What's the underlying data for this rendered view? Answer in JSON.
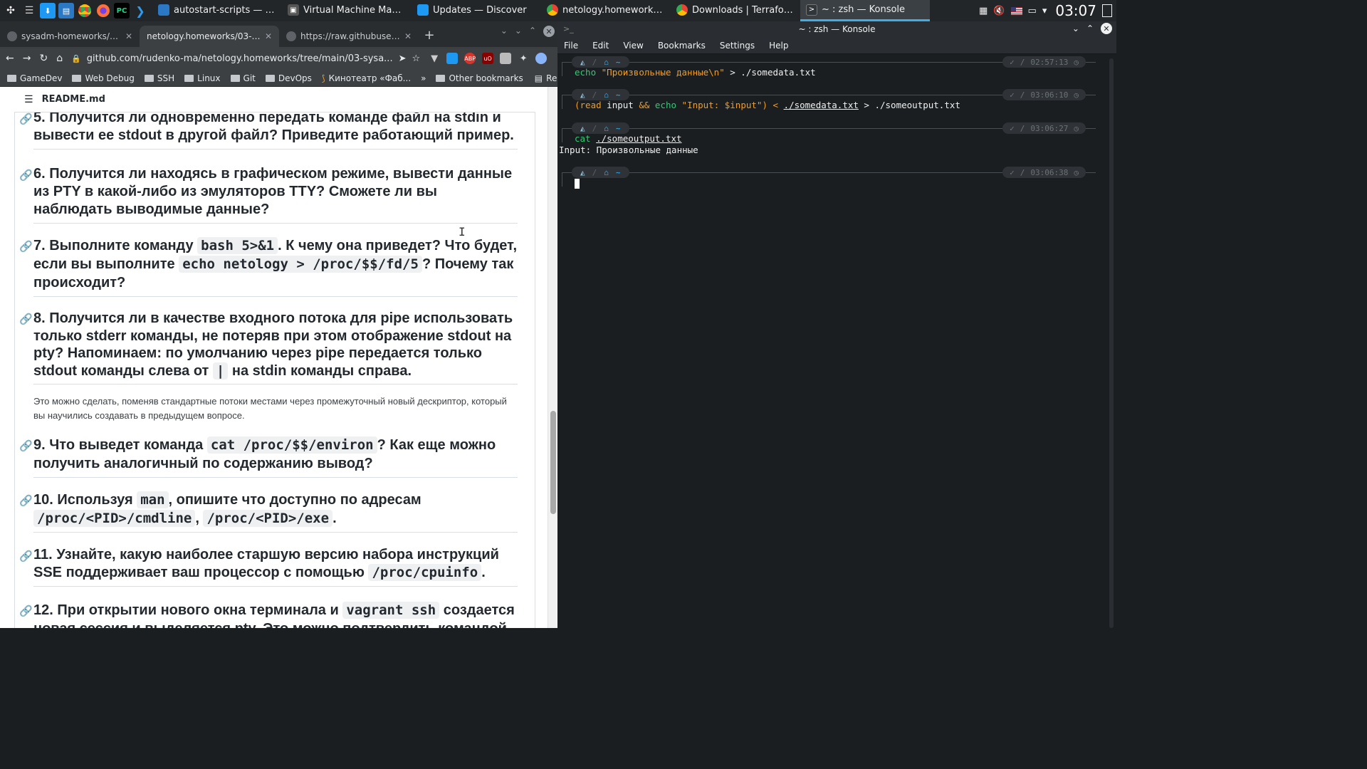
{
  "panel": {
    "tasks": [
      {
        "label": "autostart-scripts — Dolphin",
        "color": "#2b78c5"
      },
      {
        "label": "Virtual Machine Manager",
        "color": "#555"
      },
      {
        "label": "Updates — Discover",
        "color": "#1d99f3"
      },
      {
        "label": "netology.homeworks/03-sysad...",
        "color": "#e0453a"
      },
      {
        "label": "Downloads | Terraform by Has...",
        "color": "#e0453a"
      },
      {
        "label": "~ : zsh — Konsole",
        "color": "#31363b"
      }
    ],
    "clock": "03:07"
  },
  "browser": {
    "tabs": [
      {
        "label": "sysadm-homeworks/README.m"
      },
      {
        "label": "netology.homeworks/03-sysa"
      },
      {
        "label": "https://raw.githubuserconte"
      }
    ],
    "url": "github.com/rudenko-ma/netology.homeworks/tree/main/03-sysa...",
    "bookmarks": [
      "GameDev",
      "Web Debug",
      "SSH",
      "Linux",
      "Git",
      "DevOps",
      "Кинотеатр «Фаб..."
    ],
    "bookmarks_more": "»",
    "other_bookmarks": "Other bookmarks",
    "reading_list": "Reading list"
  },
  "readme": {
    "file": "README.md",
    "q5": "5. Получится ли одновременно передать команде файл на stdin и вывести ее stdout в другой файл? Приведите работающий пример.",
    "q6": "6. Получится ли находясь в графическом режиме, вывести данные из PTY в какой-либо из эмуляторов TTY? Сможете ли вы наблюдать выводимые данные?",
    "q7_a": "7. Выполните команду ",
    "q7_code1": "bash 5>&1",
    "q7_b": ". К чему она приведет? Что будет, если вы выполните ",
    "q7_code2": "echo netology > /proc/$$/fd/5",
    "q7_c": "? Почему так происходит?",
    "q8_a": "8. Получится ли в качестве входного потока для pipe использовать только stderr команды, не потеряв при этом отображение stdout на pty? Напоминаем: по умолчанию через pipe передается только stdout команды слева от ",
    "q8_code": "|",
    "q8_b": " на stdin команды справа.",
    "a8": "Это можно сделать, поменяв стандартные потоки местами через промежуточный новый дескриптор, который вы научились создавать в предыдущем вопросе.",
    "q9_a": "9. Что выведет команда ",
    "q9_code": "cat /proc/$$/environ",
    "q9_b": "? Как еще можно получить аналогичный по содержанию вывод?",
    "q10_a": "10. Используя ",
    "q10_code1": "man",
    "q10_b": ", опишите что доступно по адресам ",
    "q10_code2": "/proc/<PID>/cmdline",
    "q10_c": ", ",
    "q10_code3": "/proc/<PID>/exe",
    "q10_d": ".",
    "q11_a": "11. Узнайте, какую наиболее старшую версию набора инструкций SSE поддерживает ваш процессор с помощью ",
    "q11_code": "/proc/cpuinfo",
    "q11_b": ".",
    "q12_a": "12. При открытии нового окна терминала и ",
    "q12_code": "vagrant ssh",
    "q12_b": " создается новая сессия и выделяется pty. Это можно подтвердить командой"
  },
  "konsole": {
    "title": "~ : zsh — Konsole",
    "menu": [
      "File",
      "Edit",
      "View",
      "Bookmarks",
      "Settings",
      "Help"
    ],
    "prompt_dir": "~",
    "blocks": [
      {
        "time": "02:57:13"
      },
      {
        "time": "03:06:10"
      },
      {
        "time": "03:06:27"
      },
      {
        "time": "03:06:38"
      }
    ],
    "cmd1_kw": "echo",
    "cmd1_str": "\"Произвольные данные\\n\"",
    "cmd1_redir": " > ./somedata.txt",
    "cmd2_open": "(read",
    "cmd2_input": " input ",
    "cmd2_and": "&&",
    "cmd2_echo": " echo ",
    "cmd2_str": "\"Input: $input\"",
    "cmd2_close": ") < ",
    "cmd2_file1": "./somedata.txt",
    "cmd2_gt": " > ./someoutput.txt",
    "cmd3_kw": "cat",
    "cmd3_file": "./someoutput.txt",
    "output3": "Input: Произвольные данные"
  }
}
